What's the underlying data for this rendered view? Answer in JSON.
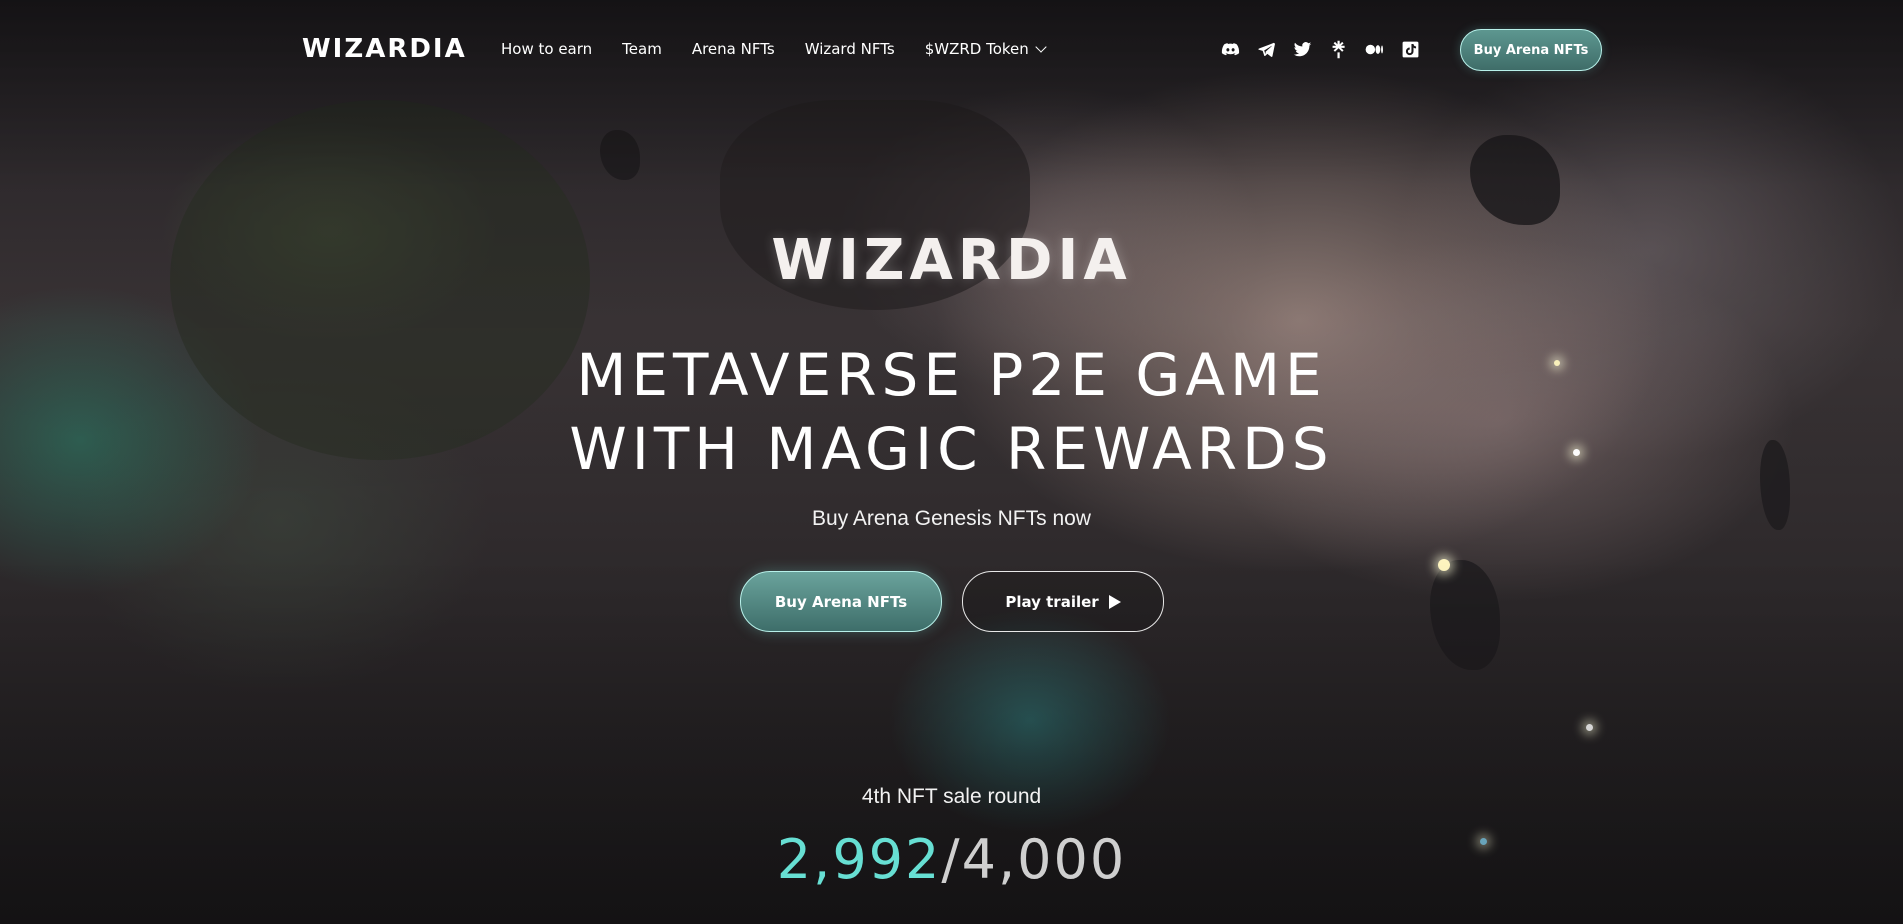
{
  "nav": {
    "logo": "WIZARDIA",
    "links": [
      {
        "label": "How to earn"
      },
      {
        "label": "Team"
      },
      {
        "label": "Arena NFTs"
      },
      {
        "label": "Wizard NFTs"
      },
      {
        "label": "$WZRD Token"
      }
    ],
    "socials": [
      "discord-icon",
      "telegram-icon",
      "twitter-icon",
      "linktree-icon",
      "medium-icon",
      "tiktok-icon"
    ],
    "cta": "Buy Arena NFTs"
  },
  "hero": {
    "brand": "WIZARDIA",
    "headline_line1": "METAVERSE P2E GAME",
    "headline_line2": "WITH MAGIC REWARDS",
    "subline": "Buy Arena Genesis NFTs now",
    "buy_button": "Buy Arena NFTs",
    "trailer_button": "Play trailer",
    "sale_label": "4th NFT sale round",
    "sold": "2,992",
    "separator": "/",
    "total": "4,000"
  },
  "colors": {
    "accent": "#67dfd3",
    "button_fill": "#4f847e",
    "button_border": "#b8f1ea"
  }
}
